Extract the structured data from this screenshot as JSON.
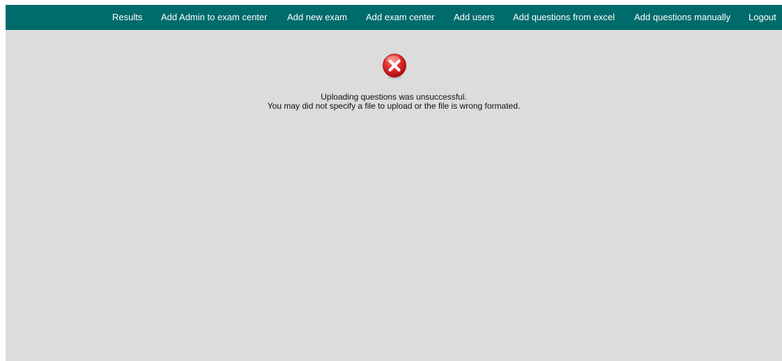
{
  "nav": {
    "items": [
      {
        "label": "Results"
      },
      {
        "label": "Add Admin to exam center"
      },
      {
        "label": "Add new exam"
      },
      {
        "label": "Add exam center"
      },
      {
        "label": "Add users"
      },
      {
        "label": "Add questions from excel"
      },
      {
        "label": "Add questions manually"
      },
      {
        "label": "Logout"
      }
    ]
  },
  "error": {
    "icon": "error-x-icon",
    "title": "Uploading questions was unsuccessful.",
    "detail": "You may did not specify a file to upload or the file is wrong formated."
  },
  "colors": {
    "navbar_bg": "#006b6b",
    "page_bg": "#dcdcdc",
    "error_red": "#d9262c"
  }
}
